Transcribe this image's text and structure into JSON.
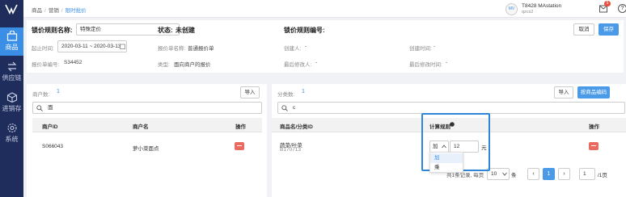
{
  "topbar": {
    "breadcrumb": [
      "商品",
      "营销",
      "限时批价"
    ],
    "user_line1": "T8428 MAstation",
    "user_line2": "qzcs2",
    "avatar_text": "MV",
    "notify_count": "5",
    "help_label": "?"
  },
  "sidebar": {
    "items": [
      {
        "label": "商品",
        "icon": "bag-icon"
      },
      {
        "label": "供应链",
        "icon": "swap-icon"
      },
      {
        "label": "进销存",
        "icon": "box-icon"
      },
      {
        "label": "系统",
        "icon": "gear-icon"
      }
    ]
  },
  "header": {
    "rule_name_label": "锁价规则名称:",
    "rule_name_value": "特殊定价",
    "status_label": "状态:",
    "status_value": "未创建",
    "rule_no_label": "锁价规则编号:",
    "cancel_label": "取消",
    "save_label": "保存",
    "start_time_label": "起止时间:",
    "start_time_value": "2020-03-11 ~ 2020-03-13",
    "quote_name_label": "报价单名称:",
    "quote_name_value": "普通报价单",
    "creator_label": "创建人:",
    "creator_value": "-",
    "created_time_label": "创建时间:",
    "created_time_value": "-",
    "quote_no_label": "报价单编号:",
    "quote_no_value": "S34452",
    "type_label": "类型:",
    "type_value": "面向商户的报价",
    "modifier_label": "最后修改人:",
    "modifier_value": "-",
    "modified_time_label": "最后修改时间:",
    "modified_time_value": "-"
  },
  "left_panel": {
    "count_label": "商户数:",
    "count_value": "1",
    "import_label": "导入",
    "search_value": "面",
    "columns": [
      "商户ID",
      "商户名",
      "操作"
    ],
    "rows": [
      {
        "id": "S066043",
        "name": "萝小菜面点"
      }
    ]
  },
  "right_panel": {
    "count_label": "分类数:",
    "count_value": "1",
    "import_label": "导入",
    "add_label": "按商品编码",
    "search_value": "c",
    "columns": [
      "商品名/分类ID",
      "计算规则",
      "操作"
    ],
    "rows": [
      {
        "name": "蔬菜/叶菜",
        "id": "B170713",
        "rule_op": "加",
        "rule_value": "12",
        "unit": "元"
      }
    ],
    "dropdown_options": [
      "加",
      "乘"
    ],
    "pagination": {
      "summary": "共1条记录, 每页",
      "page_size": "10",
      "page_size_unit": "条",
      "prev": "‹",
      "current": "1",
      "next": "›",
      "goto_value": "1",
      "total_pages": "/1页"
    }
  }
}
